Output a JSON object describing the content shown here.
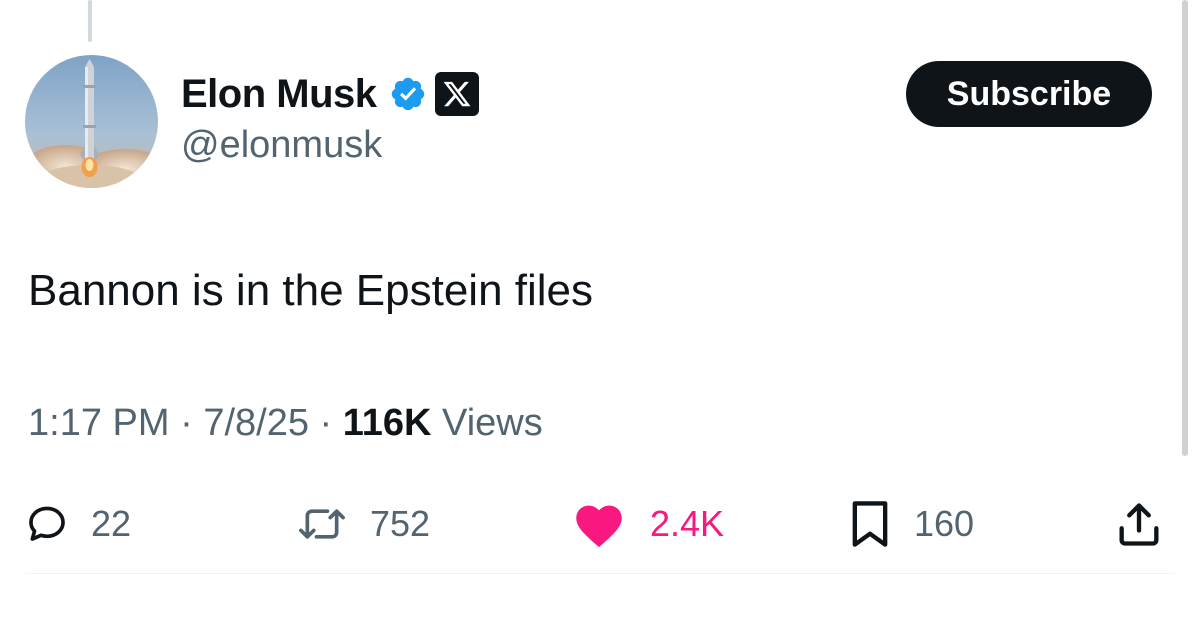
{
  "author": {
    "display_name": "Elon Musk",
    "handle": "@elonmusk",
    "verified_icon": "verified-badge-icon",
    "affiliate_icon": "x-logo-icon",
    "avatar": "rocket-launch-avatar"
  },
  "subscribe_label": "Subscribe",
  "tweet": {
    "text": "Bannon is in the Epstein files"
  },
  "meta": {
    "time": "1:17 PM",
    "separator": " · ",
    "date": "7/8/25",
    "views_count": "116K",
    "views_label": " Views"
  },
  "actions": {
    "reply": {
      "icon": "reply-icon",
      "count": "22"
    },
    "repost": {
      "icon": "repost-icon",
      "count": "752"
    },
    "like": {
      "icon": "heart-icon",
      "count": "2.4K",
      "liked": true
    },
    "bookmark": {
      "icon": "bookmark-icon",
      "count": "160"
    },
    "share": {
      "icon": "share-icon"
    }
  },
  "colors": {
    "text_primary": "#0f1419",
    "text_secondary": "#536471",
    "verified_blue": "#1d9bf0",
    "like_pink": "#f91880",
    "button_dark": "#0f1419"
  }
}
